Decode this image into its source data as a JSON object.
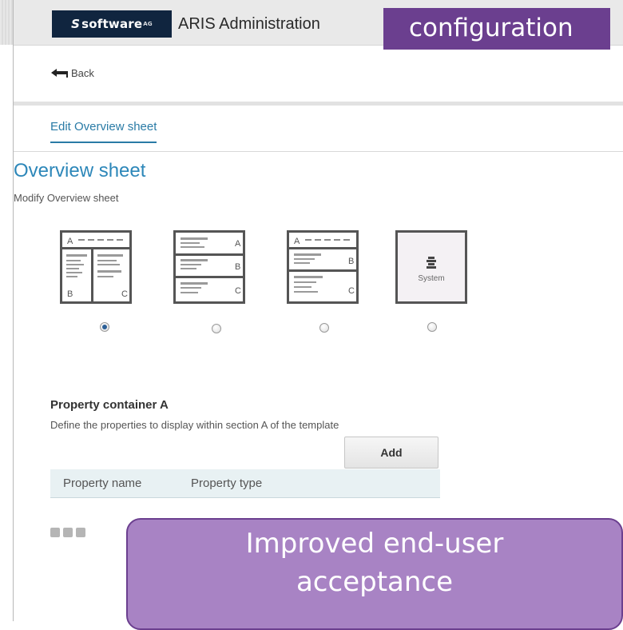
{
  "header": {
    "logo_text": "software",
    "logo_suffix": "AG",
    "logo_mark": "S",
    "app_title": "ARIS Administration",
    "banner_text": "configuration"
  },
  "nav": {
    "back_label": "Back"
  },
  "tabs": [
    {
      "label": "Edit Overview sheet",
      "active": true
    }
  ],
  "page": {
    "title": "Overview sheet",
    "subtitle": "Modify Overview sheet"
  },
  "templates": [
    {
      "id": "layout-abc",
      "sections": [
        "A",
        "B",
        "C"
      ],
      "selected": true
    },
    {
      "id": "layout-stacked",
      "sections": [
        "A",
        "B",
        "C"
      ],
      "selected": false
    },
    {
      "id": "layout-two-rows",
      "sections": [
        "A",
        "B",
        "C"
      ],
      "selected": false
    },
    {
      "id": "layout-system",
      "label": "System",
      "selected": false
    }
  ],
  "property_container": {
    "title": "Property container A",
    "description": "Define the properties to display within section A of the template",
    "add_label": "Add",
    "columns": [
      "Property name",
      "Property type"
    ]
  },
  "callout": {
    "line1": "Improved end-user",
    "line2": "acceptance"
  },
  "colors": {
    "accent": "#2d87b9",
    "banner": "#6b3f8f",
    "callout_bg": "#a883c4"
  }
}
